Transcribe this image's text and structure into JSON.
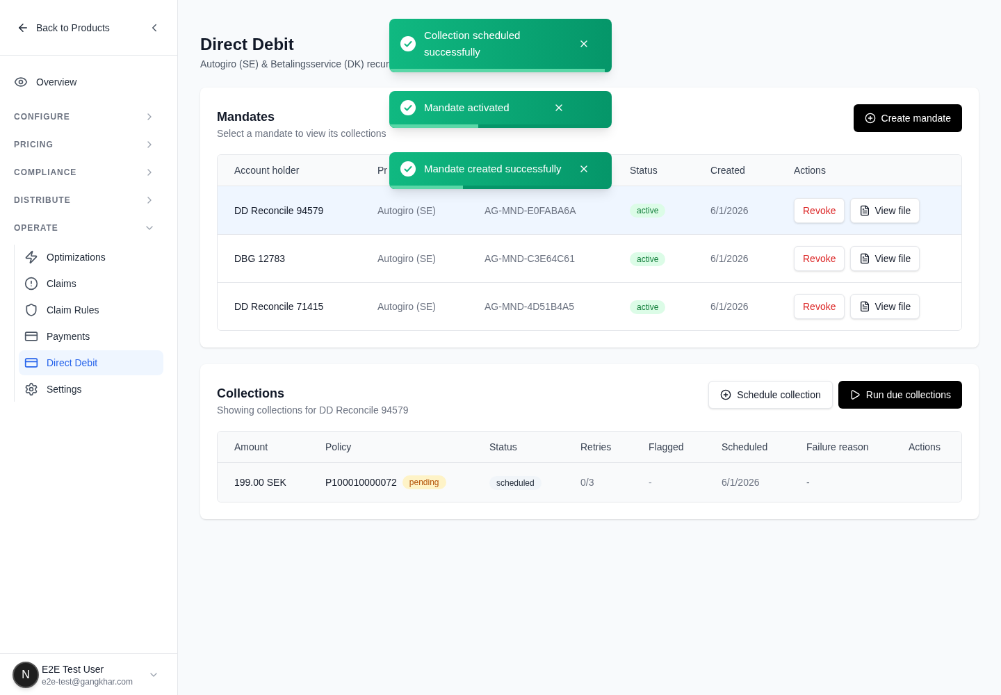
{
  "sidebar": {
    "back_link": "Back to Products",
    "nav": [
      {
        "kind": "link",
        "label": "Overview"
      },
      {
        "kind": "section",
        "label": "CONFIGURE",
        "expanded": false
      },
      {
        "kind": "section",
        "label": "PRICING",
        "expanded": false
      },
      {
        "kind": "section",
        "label": "COMPLIANCE",
        "expanded": false
      },
      {
        "kind": "section",
        "label": "DISTRIBUTE",
        "expanded": false
      },
      {
        "kind": "section",
        "label": "OPERATE",
        "expanded": true,
        "children": [
          {
            "label": "Optimizations",
            "selected": false
          },
          {
            "label": "Claims",
            "selected": false
          },
          {
            "label": "Claim Rules",
            "selected": false
          },
          {
            "label": "Payments",
            "selected": false
          },
          {
            "label": "Direct Debit",
            "selected": true
          },
          {
            "label": "Settings",
            "selected": false
          }
        ]
      }
    ],
    "user": {
      "avatar": "N",
      "name": "E2E Test User",
      "email": "e2e-test@gangkhar.com"
    }
  },
  "page": {
    "title": "Direct Debit",
    "subtitle": "Autogiro (SE) & Betalingsservice (DK) recur"
  },
  "mandates": {
    "title": "Mandates",
    "subtitle": "Select a mandate to view its collections",
    "button": "Create mandate",
    "columns": [
      "Account holder",
      "Pr",
      "",
      "Status",
      "Created",
      "Actions"
    ],
    "rows": [
      {
        "selected": true,
        "account_holder": "DD Reconcile 94579",
        "provider": "Autogiro (SE)",
        "column_3": "AG-MND-E0FABA6A",
        "status": {
          "label": "active",
          "kind": "success"
        },
        "created": "6/1/2026",
        "actions": [
          "Revoke",
          "View file"
        ]
      },
      {
        "selected": false,
        "account_holder": "DBG 12783",
        "provider": "Autogiro (SE)",
        "column_3": "AG-MND-C3E64C61",
        "status": {
          "label": "active",
          "kind": "success"
        },
        "created": "6/1/2026",
        "actions": [
          "Revoke",
          "View file"
        ]
      },
      {
        "selected": false,
        "account_holder": "DD Reconcile 71415",
        "provider": "Autogiro (SE)",
        "column_3": "AG-MND-4D51B4A5",
        "status": {
          "label": "active",
          "kind": "success"
        },
        "created": "6/1/2026",
        "actions": [
          "Revoke",
          "View file"
        ]
      }
    ]
  },
  "collections": {
    "title": "Collections",
    "subtitle": "Showing collections for DD Reconcile 94579",
    "buttons": [
      "Schedule collection",
      "Run due collections"
    ],
    "columns": [
      "Amount",
      "Policy",
      "Status",
      "Retries",
      "Flagged",
      "Scheduled",
      "Failure reason",
      "Actions"
    ],
    "rows": [
      {
        "amount": "199.00 SEK",
        "policy": "P100010000072",
        "policy_badge": {
          "label": "pending",
          "kind": "warning"
        },
        "status": {
          "label": "scheduled",
          "kind": "neutral"
        },
        "retries": "0/3",
        "flagged": "-",
        "scheduled": "6/1/2026",
        "failure_reason": "-"
      }
    ]
  },
  "toasts": [
    {
      "message": "Collection scheduled successfully",
      "level": 0.97
    },
    {
      "message": "Mandate activated",
      "level": 0.4
    },
    {
      "message": "Mandate created successfully",
      "level": 0.33
    }
  ]
}
